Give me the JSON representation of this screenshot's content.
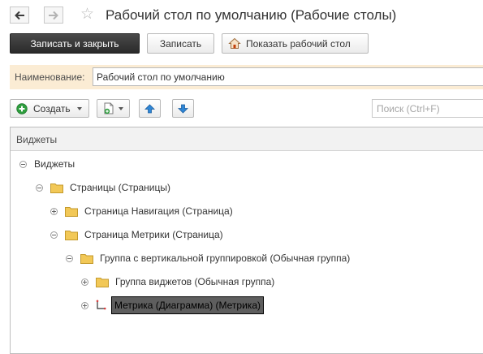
{
  "window": {
    "title": "Рабочий стол по умолчанию (Рабочие столы)",
    "nav_back_icon": "arrow-left-icon",
    "nav_forward_icon": "arrow-right-icon",
    "favorite_icon": "star-icon"
  },
  "command_bar": {
    "save_close_label": "Записать и закрыть",
    "save_label": "Записать",
    "show_desktop_label": "Показать рабочий стол",
    "show_desktop_icon": "house-icon"
  },
  "form": {
    "name_label": "Наименование:",
    "name_value": "Рабочий стол по умолчанию"
  },
  "toolbar": {
    "create_label": "Создать",
    "create_icon": "plus-circle-icon",
    "add_icon": "document-add-icon",
    "move_up_icon": "arrow-up-icon",
    "move_down_icon": "arrow-down-icon",
    "search_placeholder": "Поиск (Ctrl+F)"
  },
  "tree": {
    "column_header": "Виджеты",
    "rows": [
      {
        "label": "Виджеты",
        "state": "expanded",
        "folder": false,
        "selected": false
      },
      {
        "label": "Страницы (Страницы)",
        "state": "expanded",
        "folder": true,
        "selected": false
      },
      {
        "label": "Страница Навигация (Страница)",
        "state": "collapsed",
        "folder": true,
        "selected": false
      },
      {
        "label": "Страница Метрики (Страница)",
        "state": "expanded",
        "folder": true,
        "selected": false
      },
      {
        "label": "Группа с вертикальной группировкой (Обычная группа)",
        "state": "expanded",
        "folder": true,
        "selected": false
      },
      {
        "label": "Группа виджетов (Обычная группа)",
        "state": "collapsed",
        "folder": true,
        "selected": false
      },
      {
        "label": "Метрика (Диаграмма) (Метрика)",
        "state": "collapsed",
        "folder": false,
        "icon": "chart-axes-icon",
        "selected": true
      }
    ]
  },
  "colors": {
    "primary_button": "#333333",
    "name_row_background": "#fbecd4",
    "folder": "#f2c857",
    "selection": "#5e5e5e",
    "arrow_button_blue": "#2f86d6",
    "create_green": "#2e9e3e"
  }
}
